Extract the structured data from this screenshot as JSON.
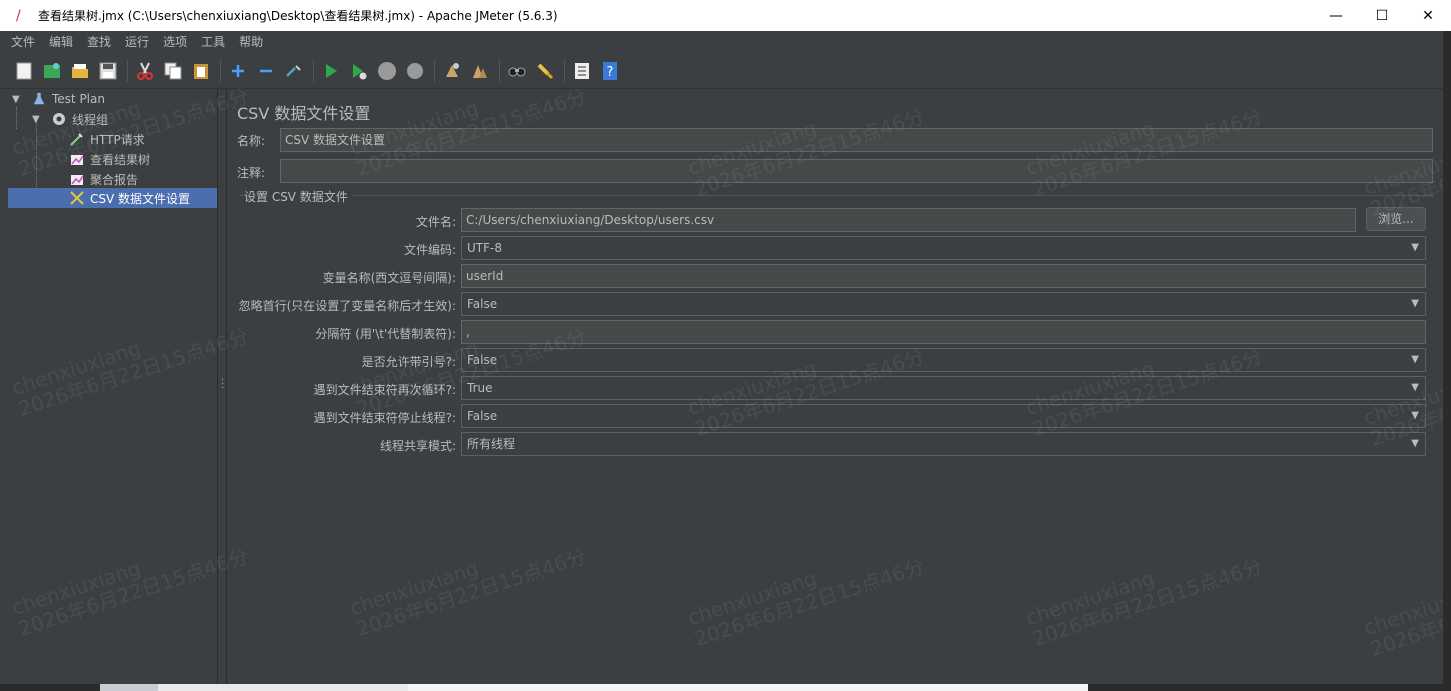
{
  "window": {
    "title": "查看结果树.jmx (C:\\Users\\chenxiuxiang\\Desktop\\查看结果树.jmx) - Apache JMeter (5.6.3)",
    "minimize": "—",
    "maximize": "☐",
    "close": "✕"
  },
  "menu": [
    "文件",
    "编辑",
    "查找",
    "运行",
    "选项",
    "工具",
    "帮助"
  ],
  "toolbar": {
    "icons": [
      "new-icon",
      "templates-icon",
      "open-icon",
      "save-icon",
      "cut-icon",
      "copy-icon",
      "paste-icon",
      "expand-icon",
      "collapse-icon",
      "toggle-icon",
      "start-icon",
      "start-no-pause-icon",
      "stop-icon",
      "shutdown-icon",
      "clear-icon",
      "clear-all-icon",
      "search-icon",
      "reset-search-icon",
      "function-helper-icon",
      "help-icon"
    ]
  },
  "tree": {
    "items": [
      {
        "label": "Test Plan",
        "icon": "flask-icon",
        "level": 0,
        "expanded": true
      },
      {
        "label": "线程组",
        "icon": "gear-icon",
        "level": 1,
        "expanded": true
      },
      {
        "label": "HTTP请求",
        "icon": "pipette-icon",
        "level": 2
      },
      {
        "label": "查看结果树",
        "icon": "chart-icon",
        "level": 2
      },
      {
        "label": "聚合报告",
        "icon": "chart-icon",
        "level": 2
      },
      {
        "label": "CSV 数据文件设置",
        "icon": "scissors-icon",
        "level": 2,
        "selected": true
      }
    ]
  },
  "panel": {
    "title": "CSV 数据文件设置",
    "name_label": "名称:",
    "name_value": "CSV 数据文件设置",
    "comment_label": "注释:",
    "comment_value": "",
    "group_title": "设置 CSV 数据文件",
    "browse_label": "浏览...",
    "fields": [
      {
        "label": "文件名:",
        "type": "text",
        "value": "C:/Users/chenxiuxiang/Desktop/users.csv"
      },
      {
        "label": "文件编码:",
        "type": "combo",
        "value": "UTF-8"
      },
      {
        "label": "变量名称(西文逗号间隔):",
        "type": "text",
        "value": "userId"
      },
      {
        "label": "忽略首行(只在设置了变量名称后才生效):",
        "type": "combo",
        "value": "False"
      },
      {
        "label": "分隔符 (用'\\t'代替制表符):",
        "type": "text",
        "value": ","
      },
      {
        "label": "是否允许带引号?:",
        "type": "combo",
        "value": "False"
      },
      {
        "label": "遇到文件结束符再次循环?:",
        "type": "combo",
        "value": "True"
      },
      {
        "label": "遇到文件结束符停止线程?:",
        "type": "combo",
        "value": "False"
      },
      {
        "label": "线程共享模式:",
        "type": "combo",
        "value": "所有线程"
      }
    ]
  },
  "watermark": {
    "line1": "chenxiuxiang",
    "line2": "2026年6月22日15点46分"
  },
  "colors": {
    "background": "#3c3f41",
    "selection": "#4b6eaf",
    "text": "#bbbbbb",
    "field": "#45494a"
  }
}
